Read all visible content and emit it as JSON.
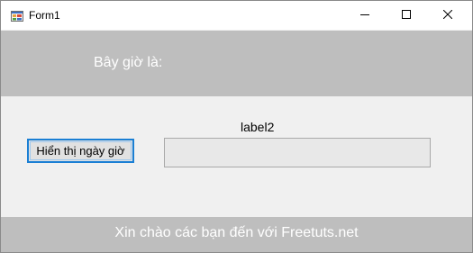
{
  "window": {
    "title": "Form1",
    "icon": "winforms-app-icon",
    "controls": {
      "minimize_icon": "minimize-icon",
      "maximize_icon": "maximize-icon",
      "close_icon": "close-icon"
    }
  },
  "header_panel": {
    "text": "Bây giờ là:",
    "color": "#bebebe"
  },
  "main": {
    "label2": "label2",
    "show_button_label": "Hiển thị ngày giờ",
    "output_value": ""
  },
  "footer_panel": {
    "text": "Xin chào các bạn đến với Freetuts.net",
    "color": "#bebebe"
  },
  "colors": {
    "focus_border": "#1a7fd4",
    "client_background": "#f0f0f0"
  }
}
